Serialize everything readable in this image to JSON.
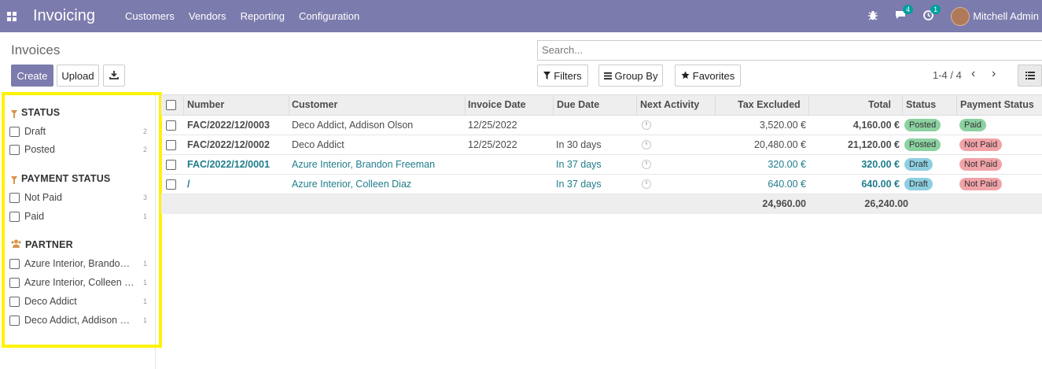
{
  "navbar": {
    "app_title": "Invoicing",
    "menu": [
      "Customers",
      "Vendors",
      "Reporting",
      "Configuration"
    ],
    "messages_badge": "4",
    "activities_badge": "1",
    "user_name": "Mitchell Admin"
  },
  "control": {
    "page_title": "Invoices",
    "create_label": "Create",
    "upload_label": "Upload",
    "search_placeholder": "Search...",
    "filters_label": "Filters",
    "groupby_label": "Group By",
    "favorites_label": "Favorites",
    "pager": "1-4 / 4"
  },
  "sidebar": {
    "status_title": "STATUS",
    "status_items": [
      {
        "label": "Draft",
        "count": "2"
      },
      {
        "label": "Posted",
        "count": "2"
      }
    ],
    "payment_title": "PAYMENT STATUS",
    "payment_items": [
      {
        "label": "Not Paid",
        "count": "3"
      },
      {
        "label": "Paid",
        "count": "1"
      }
    ],
    "partner_title": "PARTNER",
    "partner_items": [
      {
        "label": "Azure Interior, Brandon Freeman",
        "count": "1"
      },
      {
        "label": "Azure Interior, Colleen Diaz",
        "count": "1"
      },
      {
        "label": "Deco Addict",
        "count": "1"
      },
      {
        "label": "Deco Addict, Addison Olson",
        "count": "1"
      }
    ]
  },
  "table": {
    "headers": {
      "number": "Number",
      "customer": "Customer",
      "invoice_date": "Invoice Date",
      "due_date": "Due Date",
      "next_activity": "Next Activity",
      "tax_excluded": "Tax Excluded",
      "total": "Total",
      "status": "Status",
      "payment_status": "Payment Status"
    },
    "rows": [
      {
        "number": "FAC/2022/12/0003",
        "customer": "Deco Addict, Addison Olson",
        "invoice_date": "12/25/2022",
        "due_date": "",
        "tax_excluded": "3,520.00 €",
        "total": "4,160.00 €",
        "status": "Posted",
        "payment_status": "Paid"
      },
      {
        "number": "FAC/2022/12/0002",
        "customer": "Deco Addict",
        "invoice_date": "12/25/2022",
        "due_date": "In 30 days",
        "tax_excluded": "20,480.00 €",
        "total": "21,120.00 €",
        "status": "Posted",
        "payment_status": "Not Paid"
      },
      {
        "number": "FAC/2022/12/0001",
        "customer": "Azure Interior, Brandon Freeman",
        "invoice_date": "",
        "due_date": "In 37 days",
        "tax_excluded": "320.00 €",
        "total": "320.00 €",
        "status": "Draft",
        "payment_status": "Not Paid"
      },
      {
        "number": "/",
        "customer": "Azure Interior, Colleen Diaz",
        "invoice_date": "",
        "due_date": "In 37 days",
        "tax_excluded": "640.00 €",
        "total": "640.00 €",
        "status": "Draft",
        "payment_status": "Not Paid"
      }
    ],
    "footer": {
      "tax_excluded": "24,960.00",
      "total": "26,240.00"
    }
  }
}
